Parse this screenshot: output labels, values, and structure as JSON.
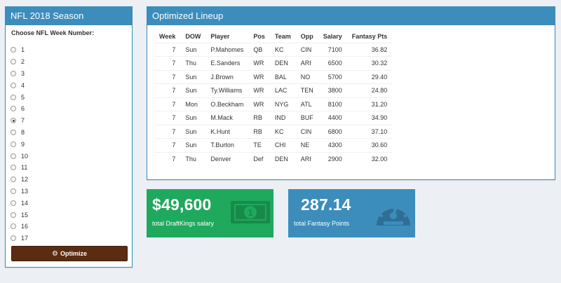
{
  "left_panel": {
    "title": "NFL 2018 Season",
    "prompt": "Choose NFL Week Number:",
    "weeks": [
      "1",
      "2",
      "3",
      "4",
      "5",
      "6",
      "7",
      "8",
      "9",
      "10",
      "11",
      "12",
      "13",
      "14",
      "15",
      "16",
      "17"
    ],
    "selected_week": "7",
    "optimize_label": "Optimize",
    "button_color": "#5c2c12"
  },
  "lineup": {
    "title": "Optimized Lineup",
    "headers": [
      "Week",
      "DOW",
      "Player",
      "Pos",
      "Team",
      "Opp",
      "Salary",
      "Fantasy Pts"
    ],
    "rows": [
      [
        "7",
        "Sun",
        "P.Mahomes",
        "QB",
        "KC",
        "CIN",
        "7100",
        "36.82"
      ],
      [
        "7",
        "Thu",
        "E.Sanders",
        "WR",
        "DEN",
        "ARI",
        "6500",
        "30.32"
      ],
      [
        "7",
        "Sun",
        "J.Brown",
        "WR",
        "BAL",
        "NO",
        "5700",
        "29.40"
      ],
      [
        "7",
        "Sun",
        "Ty.Williams",
        "WR",
        "LAC",
        "TEN",
        "3800",
        "24.80"
      ],
      [
        "7",
        "Mon",
        "O.Beckham",
        "WR",
        "NYG",
        "ATL",
        "8100",
        "31.20"
      ],
      [
        "7",
        "Sun",
        "M.Mack",
        "RB",
        "IND",
        "BUF",
        "4400",
        "34.90"
      ],
      [
        "7",
        "Sun",
        "K.Hunt",
        "RB",
        "KC",
        "CIN",
        "6800",
        "37.10"
      ],
      [
        "7",
        "Sun",
        "T.Burton",
        "TE",
        "CHI",
        "NE",
        "4300",
        "30.60"
      ],
      [
        "7",
        "Thu",
        "Denver",
        "Def",
        "DEN",
        "ARI",
        "2900",
        "32.00"
      ]
    ]
  },
  "salary_box": {
    "value": "$49,600",
    "label": "total DraftKings salary",
    "color": "#1fa95d",
    "icon": "money-bill-icon"
  },
  "points_box": {
    "value": "287.14",
    "label": "total Fantasy Points",
    "color": "#3c8dbc",
    "icon": "dashboard-gauge-icon"
  }
}
